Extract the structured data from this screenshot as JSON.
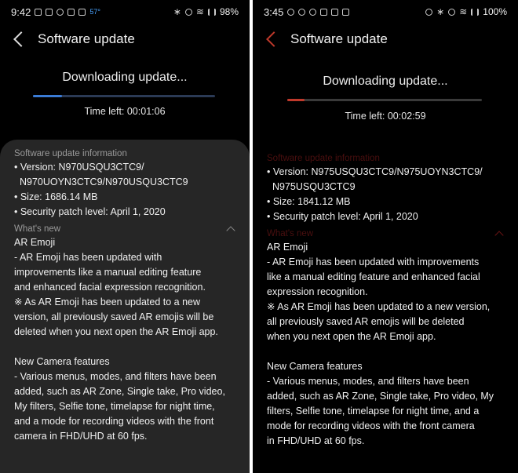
{
  "left": {
    "status": {
      "time": "9:42",
      "temp": "57°",
      "battery": "98%"
    },
    "title": "Software update",
    "downloading": "Downloading update...",
    "progress": 0.16,
    "progress_color": "#3a7bd5",
    "track_color": "#2b3a55",
    "time_left": "Time left: 00:01:06",
    "info_header": "Software update information",
    "info": [
      "• Version: N970USQU3CTC9/",
      "  N970UOYN3CTC9/N970USQU3CTC9",
      "• Size: 1686.14 MB",
      "• Security patch level: April 1, 2020"
    ],
    "whats_new_header": "What's new",
    "body": [
      "AR Emoji",
      "- AR Emoji has been updated with",
      "improvements like a manual editing feature",
      "and enhanced facial expression recognition.",
      "※ As AR Emoji has been updated to a new",
      "version, all previously saved AR emojis will be",
      "deleted when you next open the AR Emoji app.",
      "",
      "New Camera features",
      "- Various menus, modes, and filters have been",
      "added, such as AR Zone, Single take, Pro video,",
      "My filters, Selfie tone, timelapse for night time,",
      "and a mode for recording videos with the front",
      "camera in FHD/UHD at 60 fps."
    ]
  },
  "right": {
    "status": {
      "time": "3:45",
      "battery": "100%"
    },
    "title": "Software update",
    "downloading": "Downloading update...",
    "progress": 0.09,
    "progress_color": "#c0392b",
    "track_color": "#3a3a3a",
    "time_left": "Time left: 00:02:59",
    "info_header": "Software update information",
    "info": [
      "• Version: N975USQU3CTC9/N975UOYN3CTC9/",
      "  N975USQU3CTC9",
      "• Size: 1841.12 MB",
      "• Security patch level: April 1, 2020"
    ],
    "whats_new_header": "What's new",
    "body": [
      "AR Emoji",
      "- AR Emoji has been updated with improvements",
      "like a manual editing feature and enhanced facial",
      "expression recognition.",
      "※ As AR Emoji has been updated to a new version,",
      "all previously saved AR emojis will be deleted",
      "when you next open the AR Emoji app.",
      "",
      "New Camera features",
      "- Various menus, modes, and filters have been",
      "added, such as AR Zone, Single take, Pro video, My",
      "filters, Selfie tone, timelapse for night time, and a",
      "mode for recording videos with the front camera",
      "in FHD/UHD at 60 fps."
    ]
  }
}
